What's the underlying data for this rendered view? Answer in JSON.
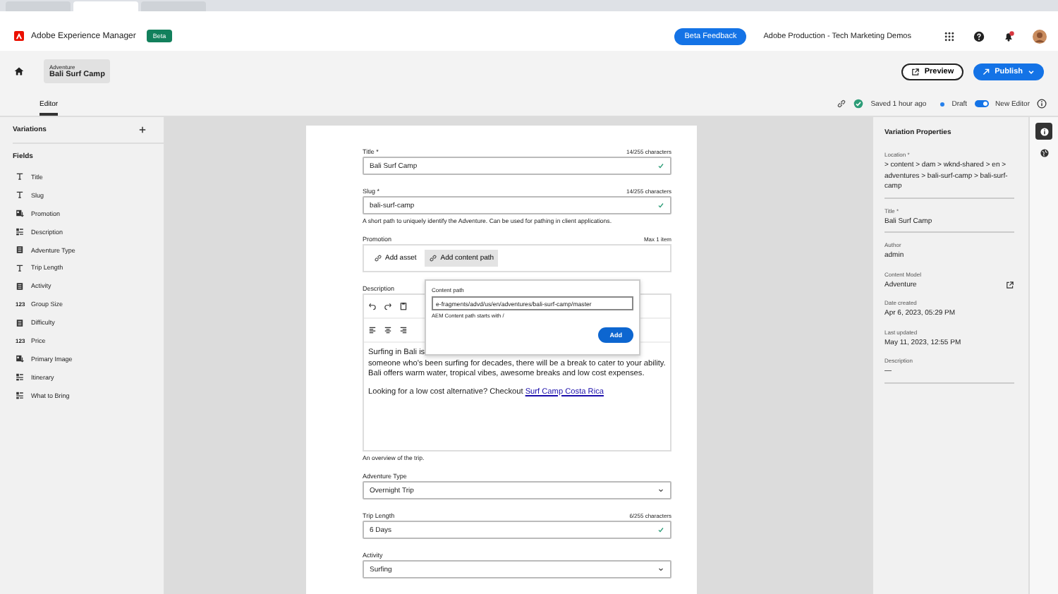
{
  "browser": {
    "tabs": [
      {
        "selected": false
      },
      {
        "selected": true
      },
      {
        "selected": false
      }
    ]
  },
  "header": {
    "app_name": "Adobe Experience Manager",
    "badge": "Beta",
    "feedback": "Beta Feedback",
    "org": "Adobe Production - Tech Marketing Demos"
  },
  "breadcrumb": {
    "type": "Adventure",
    "title": "Bali Surf Camp"
  },
  "actions": {
    "preview": "Preview",
    "publish": "Publish"
  },
  "tabs": [
    {
      "label": "Editor",
      "selected": true
    }
  ],
  "status": {
    "saved": "Saved 1 hour ago",
    "state": "Draft",
    "new_editor": {
      "label": "New Editor",
      "on": true
    }
  },
  "sidebar": {
    "variations": "Variations",
    "fields_heading": "Fields",
    "items": [
      {
        "label": "Title",
        "kind": "text"
      },
      {
        "label": "Slug",
        "kind": "text"
      },
      {
        "label": "Promotion",
        "kind": "reference"
      },
      {
        "label": "Description",
        "kind": "richtext"
      },
      {
        "label": "Adventure Type",
        "kind": "enum"
      },
      {
        "label": "Trip Length",
        "kind": "text"
      },
      {
        "label": "Activity",
        "kind": "enum"
      },
      {
        "label": "Group Size",
        "kind": "number",
        "glyph": "123"
      },
      {
        "label": "Difficulty",
        "kind": "enum"
      },
      {
        "label": "Price",
        "kind": "number",
        "glyph": "123"
      },
      {
        "label": "Primary Image",
        "kind": "reference"
      },
      {
        "label": "Itinerary",
        "kind": "richtext"
      },
      {
        "label": "What to Bring",
        "kind": "richtext"
      }
    ]
  },
  "form": {
    "fields": [
      {
        "kind": "text",
        "label": "Title *",
        "counter": "14/255 characters",
        "value": "Bali Surf Camp",
        "valid": true
      },
      {
        "kind": "text",
        "label": "Slug *",
        "counter": "14/255 characters",
        "value": "bali-surf-camp",
        "valid": true,
        "hint": "A short path to uniquely identify the Adventure. Can be used for pathing in client applications."
      },
      {
        "kind": "reference",
        "label": "Promotion",
        "counter": "Max 1 item",
        "buttons": [
          "Add asset",
          "Add content path"
        ]
      },
      {
        "kind": "richtext",
        "label": "Description",
        "hint": "An overview of the trip.",
        "lines": [
          "Surfing in Bali is",
          "someone who's been surfing for decades, there will be a break to cater to your ability. Bali offers warm water, tropical vibes, awesome breaks and low cost expenses."
        ],
        "closing": "Looking for a low cost alternative? Checkout ",
        "link": "Surf Camp Costa Rica"
      },
      {
        "kind": "select",
        "label": "Adventure Type",
        "value": "Overnight Trip"
      },
      {
        "kind": "text",
        "label": "Trip Length",
        "counter": "6/255 characters",
        "value": "6 Days",
        "valid": true
      },
      {
        "kind": "select",
        "label": "Activity",
        "value": "Surfing"
      }
    ],
    "popover": {
      "label": "Content path",
      "value": "e-fragments/advd/us/en/adventures/bali-surf-camp/master",
      "hint": "AEM Content path starts with /",
      "button": "Add"
    }
  },
  "properties": {
    "title": "Variation Properties",
    "items": [
      {
        "label": "Location *",
        "value": "> content > dam > wknd-shared > en > adventures > bali-surf-camp > bali-surf-camp",
        "editable": true
      },
      {
        "label": "Title *",
        "value": "Bali Surf Camp",
        "editable": true
      },
      {
        "label": "Author",
        "value": "admin"
      },
      {
        "label": "Content Model",
        "value": "Adventure",
        "link": true
      },
      {
        "label": "Date created",
        "value": "Apr 6, 2023, 05:29 PM"
      },
      {
        "label": "Last updated",
        "value": "May 11, 2023, 12:55 PM"
      },
      {
        "label": "Description",
        "value": "—",
        "editable": true
      }
    ]
  },
  "rail": [
    {
      "kind": "info",
      "selected": true
    },
    {
      "kind": "globe",
      "selected": false
    }
  ]
}
